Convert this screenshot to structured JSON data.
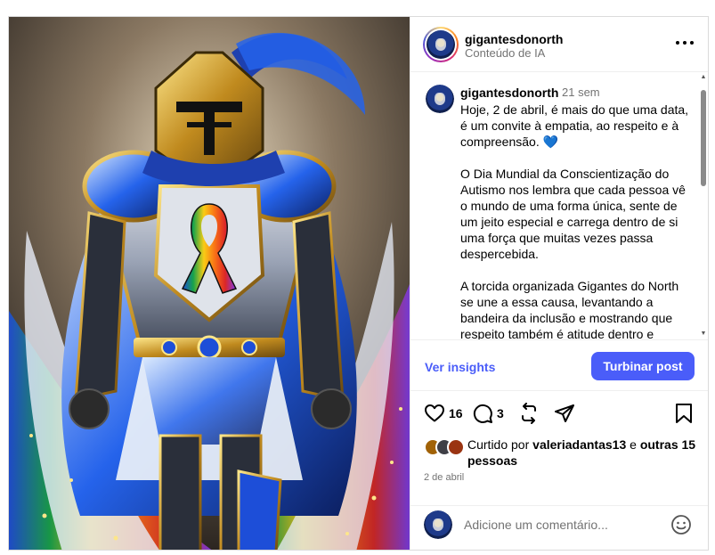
{
  "header": {
    "username": "gigantesdonorth",
    "subtitle": "Conteúdo de IA",
    "more_icon": "more-horizontal-icon"
  },
  "caption": {
    "username": "gigantesdonorth",
    "time": "21 sem",
    "text": "Hoje, 2 de abril, é mais do que uma data, é um convite à empatia, ao respeito e à compreensão. 💙\n\nO Dia Mundial da Conscientização do Autismo nos lembra que cada pessoa vê o mundo de uma forma única, sente de um jeito especial e carrega dentro de si uma força que muitas vezes passa despercebida.\n\nA torcida organizada Gigantes do North se une a essa causa, levantando a bandeira da inclusão e mostrando que respeito também é atitude dentro e"
  },
  "insights": {
    "link_label": "Ver insights",
    "boost_label": "Turbinar post",
    "accent": "#4a5df9"
  },
  "actions": {
    "like_icon": "heart-icon",
    "like_count": "16",
    "comment_icon": "comment-icon",
    "comment_count": "3",
    "repost_icon": "repost-icon",
    "share_icon": "share-icon",
    "save_icon": "bookmark-icon"
  },
  "likes": {
    "prefix": "Curtido por ",
    "user": "valeriadantas13",
    "middle": " e ",
    "others": "outras 15 pessoas"
  },
  "date": "2 de abril",
  "comment_box": {
    "placeholder": "Adicione um comentário...",
    "emoji_icon": "emoji-icon"
  },
  "colors": {
    "text_secondary": "#737373",
    "border": "#dbdbdb",
    "brand_blue": "#4a5df9"
  }
}
